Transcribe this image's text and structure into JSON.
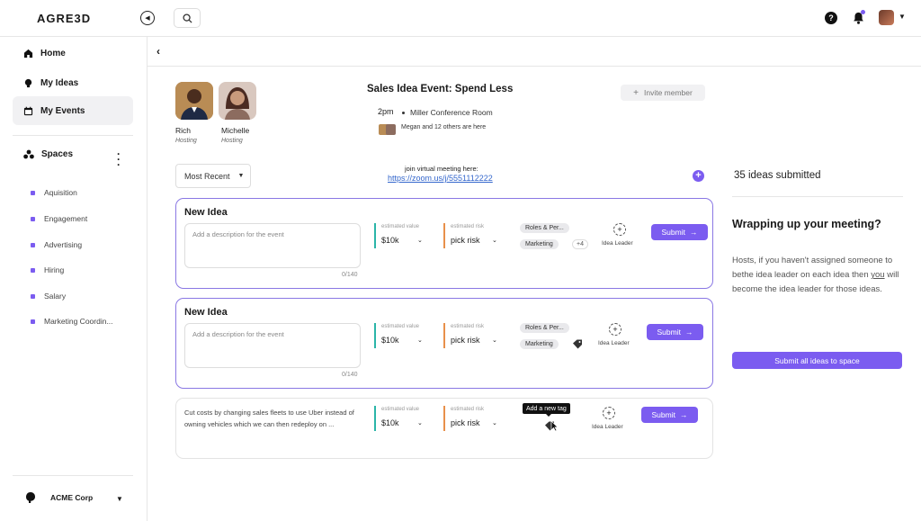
{
  "app": {
    "logo": "AGRE3D"
  },
  "colors": {
    "accent": "#7b5cf0",
    "value_bar": "#2bb5a8",
    "risk_bar": "#e8904a",
    "link": "#3366cc"
  },
  "topbar": {
    "help_glyph": "?"
  },
  "sidebar": {
    "nav": [
      {
        "label": "Home",
        "icon": "home-icon"
      },
      {
        "label": "My Ideas",
        "icon": "lightbulb-icon"
      },
      {
        "label": "My Events",
        "icon": "calendar-icon"
      }
    ],
    "spaces_label": "Spaces",
    "spaces": [
      "Aquisition",
      "Engagement",
      "Advertising",
      "Hiring",
      "Salary",
      "Marketing Coordin..."
    ],
    "org": "ACME Corp"
  },
  "event": {
    "title": "Sales Idea Event: Spend Less",
    "time": "2pm",
    "room": "Miller Conference Room",
    "attendees": "Megan and 12 others are here",
    "invite_label": "Invite member",
    "hosts": [
      {
        "name": "Rich",
        "role": "Hosting"
      },
      {
        "name": "Michelle",
        "role": "Hosting"
      }
    ]
  },
  "controls": {
    "sort_label": "Most Recent",
    "join_label": "join virtual meeting here:",
    "zoom_link": "https://zoom.us/j/5551112222"
  },
  "cards": [
    {
      "title": "New Idea",
      "desc_placeholder": "Add a description for the event",
      "char_count": "0/140",
      "value_label": "estimated value",
      "value": "$10k",
      "risk_label": "estimated risk",
      "risk": "pick risk",
      "tags": [
        "Roles & Per...",
        "Marketing"
      ],
      "more_tags": "+4",
      "leader_label": "Idea Leader",
      "submit_label": "Submit"
    },
    {
      "title": "New Idea",
      "desc_placeholder": "Add a description for the event",
      "char_count": "0/140",
      "value_label": "estimated value",
      "value": "$10k",
      "risk_label": "estimated risk",
      "risk": "pick risk",
      "tags": [
        "Roles & Per...",
        "Marketing"
      ],
      "leader_label": "Idea Leader",
      "submit_label": "Submit"
    },
    {
      "description": "Cut costs by changing sales fleets to use Uber instead of owning vehicles which we can then redeploy on ...",
      "value_label": "estimated value",
      "value": "$10k",
      "risk_label": "estimated risk",
      "risk": "pick risk",
      "tooltip": "Add a new tag",
      "leader_label": "Idea Leader",
      "submit_label": "Submit"
    }
  ],
  "right_panel": {
    "ideas_count": "35 ideas submitted",
    "title": "Wrapping up your meeting?",
    "body_pre": "Hosts, if you haven't assigned someone to bethe idea leader on each idea then ",
    "body_you": "you",
    "body_post": " will become the idea leader for those ideas.",
    "submit_all": "Submit all ideas to space"
  }
}
